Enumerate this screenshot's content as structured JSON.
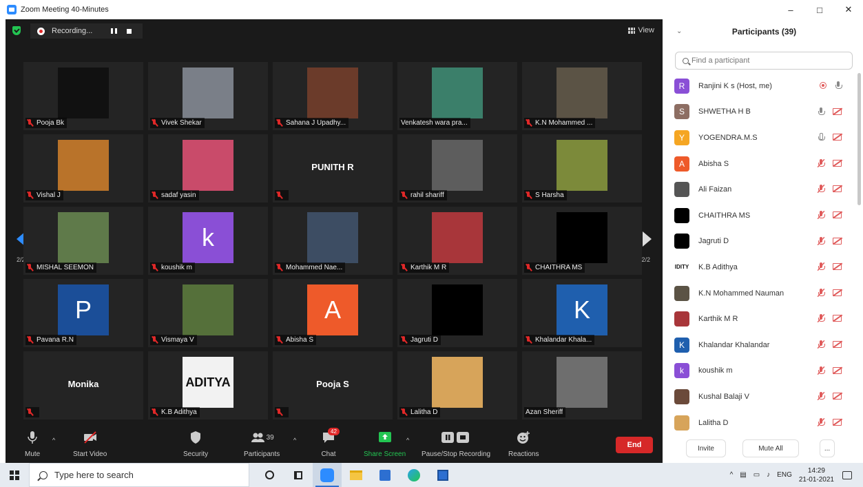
{
  "window": {
    "title": "Zoom Meeting 40-Minutes",
    "minimize": "–",
    "maximize": "□",
    "close": "✕"
  },
  "meeting": {
    "recording_label": "Recording...",
    "view_label": "View",
    "page_left": "2/2",
    "page_right": "2/2",
    "tiles": [
      {
        "name": "Pooja Bk",
        "type": "photo",
        "color": "#111111"
      },
      {
        "name": "Vivek Shekar",
        "type": "photo",
        "color": "#7a7f88"
      },
      {
        "name": "Sahana J Upadhy...",
        "type": "photo",
        "color": "#6b3b2a"
      },
      {
        "name": "Venkatesh wara pra...",
        "type": "photo",
        "color": "#3b7f6a",
        "unmuted": true
      },
      {
        "name": "K.N Mohammed ...",
        "type": "photo",
        "color": "#5b5345"
      },
      {
        "name": "Vishal J",
        "type": "photo",
        "color": "#b9732a"
      },
      {
        "name": "sadaf yasin",
        "type": "photo",
        "color": "#c94b6a"
      },
      {
        "name": "",
        "type": "text",
        "big": "PUNITH R"
      },
      {
        "name": "rahil shariff",
        "type": "photo",
        "color": "#5d5d5d"
      },
      {
        "name": "S Harsha",
        "type": "photo",
        "color": "#7c8a3a"
      },
      {
        "name": "MISHAL SEEMON",
        "type": "photo",
        "color": "#5f7a4a"
      },
      {
        "name": "koushik m",
        "type": "letter",
        "letter": "k",
        "color": "#8a4fd6"
      },
      {
        "name": "Mohammed Nae...",
        "type": "photo",
        "color": "#3d4d63"
      },
      {
        "name": "Karthik M R",
        "type": "photo",
        "color": "#a8363a"
      },
      {
        "name": "CHAITHRA MS",
        "type": "photo",
        "color": "#000000"
      },
      {
        "name": "Pavana R.N",
        "type": "letter",
        "letter": "P",
        "color": "#1b4e98"
      },
      {
        "name": "Vismaya V",
        "type": "photo",
        "color": "#55703a"
      },
      {
        "name": "Abisha S",
        "type": "letter",
        "letter": "A",
        "color": "#ee5a2a"
      },
      {
        "name": "Jagruti D",
        "type": "photo",
        "color": "#000000"
      },
      {
        "name": "Khalandar Khala...",
        "type": "letter",
        "letter": "K",
        "color": "#1f5fae"
      },
      {
        "name": "",
        "type": "text",
        "big": "Monika"
      },
      {
        "name": "K.B Adithya",
        "type": "logo",
        "logo": "ADITYA",
        "color": "#f2f2f2"
      },
      {
        "name": "",
        "type": "text",
        "big": "Pooja S"
      },
      {
        "name": "Lalitha D",
        "type": "photo",
        "color": "#d7a45a"
      },
      {
        "name": "Azan Sheriff",
        "type": "photo",
        "color": "#6e6e6e",
        "unmuted": true
      }
    ]
  },
  "toolbar": {
    "mute": "Mute",
    "start_video": "Start Video",
    "security": "Security",
    "participants": "Participants",
    "participants_count": "39",
    "chat": "Chat",
    "chat_badge": "42",
    "share_screen": "Share Screen",
    "pause_recording": "Pause/Stop Recording",
    "reactions": "Reactions",
    "end": "End",
    "share_color": "#23c552"
  },
  "participants_panel": {
    "title": "Participants (39)",
    "search_placeholder": "Find a participant",
    "invite": "Invite",
    "mute_all": "Mute All",
    "more": "...",
    "list": [
      {
        "name": "Ranjini K s (Host, me)",
        "initial": "R",
        "color": "#8a4fd6",
        "mic": "on",
        "cam": "rec"
      },
      {
        "name": "SHWETHA H B",
        "initial": "S",
        "color": "#8d6e63",
        "mic": "on",
        "cam": "off"
      },
      {
        "name": "YOGENDRA.M.S",
        "initial": "Y",
        "color": "#f5a623",
        "mic": "outline",
        "cam": "off"
      },
      {
        "name": "Abisha S",
        "initial": "A",
        "color": "#ee5a2a",
        "mic": "muted",
        "cam": "off"
      },
      {
        "name": "Ali Faizan",
        "initial": "",
        "color": "#555555",
        "mic": "muted",
        "cam": "off"
      },
      {
        "name": "CHAITHRA MS",
        "initial": "",
        "color": "#000000",
        "mic": "muted",
        "cam": "off"
      },
      {
        "name": "Jagruti D",
        "initial": "",
        "color": "#000000",
        "mic": "muted",
        "cam": "off"
      },
      {
        "name": "K.B Adithya",
        "initial": "IDITY",
        "color": "#ffffff",
        "mic": "muted",
        "cam": "off"
      },
      {
        "name": "K.N Mohammed Nauman",
        "initial": "",
        "color": "#5b5345",
        "mic": "muted",
        "cam": "off"
      },
      {
        "name": "Karthik M R",
        "initial": "",
        "color": "#a8363a",
        "mic": "muted",
        "cam": "off"
      },
      {
        "name": "Khalandar Khalandar",
        "initial": "K",
        "color": "#1f5fae",
        "mic": "muted",
        "cam": "off"
      },
      {
        "name": "koushik m",
        "initial": "k",
        "color": "#8a4fd6",
        "mic": "muted",
        "cam": "off"
      },
      {
        "name": "Kushal Balaji V",
        "initial": "",
        "color": "#6b4a3a",
        "mic": "muted",
        "cam": "off"
      },
      {
        "name": "Lalitha D",
        "initial": "",
        "color": "#d7a45a",
        "mic": "muted",
        "cam": "off"
      }
    ]
  },
  "taskbar": {
    "search_placeholder": "Type here to search",
    "lang": "ENG",
    "time": "14:29",
    "date": "21-01-2021"
  }
}
